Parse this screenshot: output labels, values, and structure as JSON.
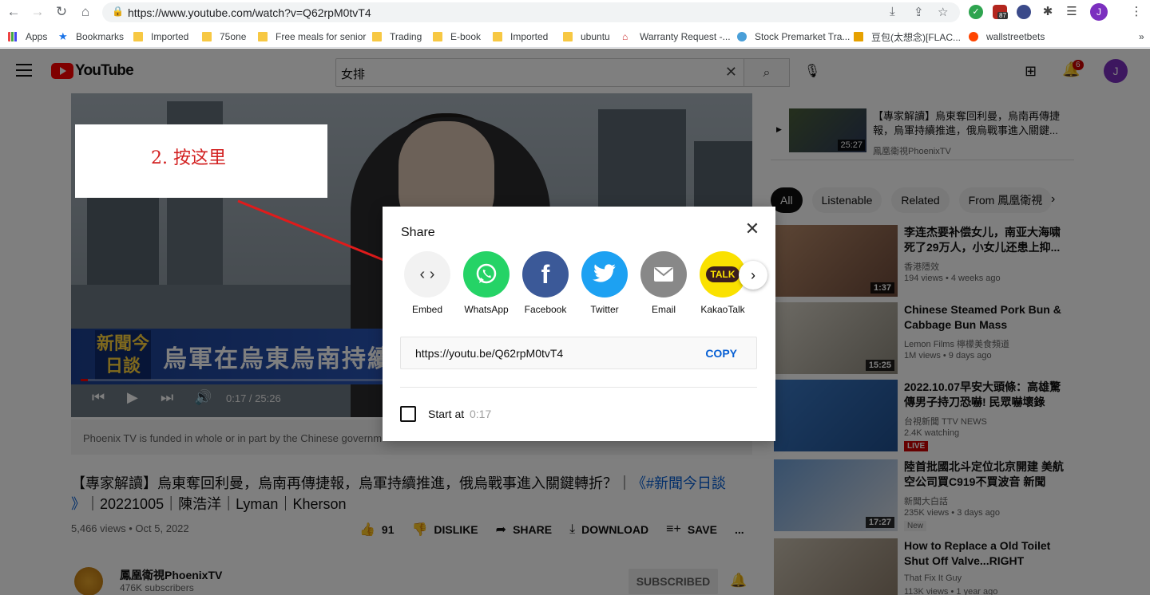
{
  "browser": {
    "url": "https://www.youtube.com/watch?v=Q62rpM0tvT4",
    "extension_badge": "87",
    "profile_initial": "J",
    "bookmarks": [
      "Apps",
      "Bookmarks",
      "Imported",
      "75one",
      "Free meals for senior",
      "Trading",
      "E-book",
      "Imported",
      "ubuntu",
      "Warranty Request -...",
      "Stock Premarket Tra...",
      "豆包(太想念)[FLAC...",
      "wallstreetbets"
    ],
    "bookmarks_more": "»"
  },
  "youtube": {
    "logo": "YouTube",
    "search_query": "女排",
    "notification_count": "6",
    "avatar_initial": "J",
    "video": {
      "caption_logo": "新聞今日談",
      "caption_text": "烏軍在烏東烏南持續推",
      "time": "0:17 / 25:26",
      "progress": 0.011,
      "funded_notice": "Phoenix TV is funded in whole or in part by the Chinese governm",
      "title_pre": "【專家解讀】烏東奪回利曼，烏南再傳捷報，烏軍持續推進，俄烏戰事進入關鍵轉折？｜",
      "title_link": "《#新聞今日談 》",
      "title_post": "｜20221005｜陳浩洋｜Lyman｜Kherson",
      "meta": "5,466 views • Oct 5, 2022",
      "likes": "91",
      "dislike": "DISLIKE",
      "share": "SHARE",
      "download": "DOWNLOAD",
      "save": "SAVE",
      "more": "...",
      "channel": "鳳凰衛視PhoenixTV",
      "subscribers": "476K subscribers",
      "subscribed": "SUBSCRIBED"
    },
    "playlist_item": {
      "title": "【專家解讀】烏東奪回利曼，烏南再傳捷報，烏軍持續推進，俄烏戰事進入關鍵...",
      "channel": "鳳凰衛視PhoenixTV",
      "duration": "25:27"
    },
    "chips": [
      "All",
      "Listenable",
      "Related",
      "From 鳳凰衛視"
    ],
    "recommendations": [
      {
        "title": "李连杰要补偿女儿，南亚大海啸死了29万人，小女儿还患上抑...",
        "channel": "香港隱效",
        "views": "194 views • 4 weeks ago",
        "duration": "1:37",
        "badge": ""
      },
      {
        "title": "Chinese Steamed Pork Bun & Cabbage Bun Mass Productio...",
        "channel": "Lemon Films 檸檬美食頻道",
        "views": "1M views • 9 days ago",
        "duration": "15:25",
        "badge": ""
      },
      {
        "title": "2022.10.07早安大頭條：高雄驚傳男子持刀恐嚇! 民眾嚇壞錄影...",
        "channel": "台視新聞 TTV NEWS",
        "views": "2.4K watching",
        "duration": "",
        "badge": "LIVE"
      },
      {
        "title": "陸首批國北斗定位北京開建 美航空公司買C919不買波音 新聞大...",
        "channel": "新聞大白話",
        "views": "235K views • 3 days ago",
        "duration": "17:27",
        "badge": "New"
      },
      {
        "title": "How to Replace a Old Toilet Shut Off Valve...RIGHT TOOLS...",
        "channel": "That Fix It Guy",
        "views": "113K views • 1 year ago",
        "duration": "",
        "badge": ""
      }
    ]
  },
  "annotation": {
    "text": "2. 按这里"
  },
  "share_dialog": {
    "title": "Share",
    "options": [
      {
        "label": "Embed",
        "icon": "embed-icon",
        "color": "#f2f2f2"
      },
      {
        "label": "WhatsApp",
        "icon": "whatsapp-icon",
        "color": "#25d366"
      },
      {
        "label": "Facebook",
        "icon": "facebook-icon",
        "color": "#3b5998"
      },
      {
        "label": "Twitter",
        "icon": "twitter-icon",
        "color": "#1da1f2"
      },
      {
        "label": "Email",
        "icon": "email-icon",
        "color": "#888888"
      },
      {
        "label": "KakaoTalk",
        "icon": "kakaotalk-icon",
        "color": "#fae100"
      }
    ],
    "link": "https://youtu.be/Q62rpM0tvT4",
    "copy_label": "COPY",
    "start_at_label": "Start at",
    "start_at_time": "0:17"
  },
  "colors": {
    "youtube_red": "#ff0000",
    "link_blue": "#065fd4",
    "annotation_red": "#d21f1f"
  }
}
